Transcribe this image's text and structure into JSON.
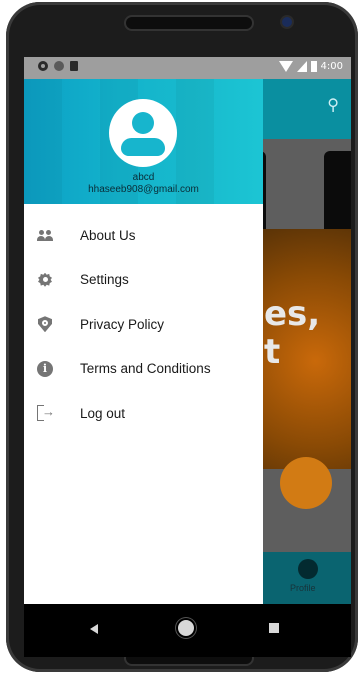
{
  "status_bar": {
    "time": "4:00"
  },
  "drawer": {
    "header": {
      "name": "abcd",
      "email": "hhaseeb908@gmail.com"
    },
    "items": [
      {
        "label": "About Us",
        "icon": "people-icon"
      },
      {
        "label": "Settings",
        "icon": "settings-icon"
      },
      {
        "label": "Privacy Policy",
        "icon": "privacy-icon"
      },
      {
        "label": "Terms and Conditions",
        "icon": "info-icon",
        "glyph": "i"
      },
      {
        "label": "Log out",
        "icon": "logout-icon"
      }
    ]
  },
  "background_app": {
    "banner_text": "es,\nt",
    "bottom_nav_label": "Profile"
  },
  "colors": {
    "drawer_header_start": "#0c9fc4",
    "drawer_header_end": "#1cc5d4",
    "icon_gray": "#757575"
  }
}
